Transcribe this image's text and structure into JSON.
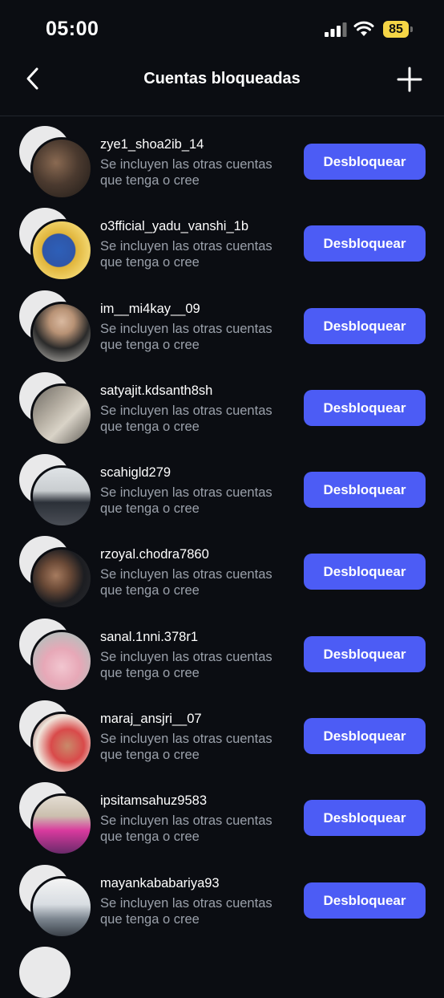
{
  "status_bar": {
    "time": "05:00",
    "battery": "85"
  },
  "header": {
    "title": "Cuentas bloqueadas",
    "back_icon": "chevron-left-icon",
    "add_icon": "plus-icon"
  },
  "accounts": [
    {
      "username": "zye1_shoa2ib_14",
      "subtitle": "Se incluyen las otras cuentas que tenga o cree",
      "button": "Desbloquear"
    },
    {
      "username": "o3fficial_yadu_vanshi_1b",
      "subtitle": "Se incluyen las otras cuentas que tenga o cree",
      "button": "Desbloquear"
    },
    {
      "username": "im__mi4kay__09",
      "subtitle": "Se incluyen las otras cuentas que tenga o cree",
      "button": "Desbloquear"
    },
    {
      "username": "satyajit.kdsanth8sh",
      "subtitle": "Se incluyen las otras cuentas que tenga o cree",
      "button": "Desbloquear"
    },
    {
      "username": "scahigld279",
      "subtitle": "Se incluyen las otras cuentas que tenga o cree",
      "button": "Desbloquear"
    },
    {
      "username": "rzoyal.chodra7860",
      "subtitle": "Se incluyen las otras cuentas que tenga o cree",
      "button": "Desbloquear"
    },
    {
      "username": "sanal.1nni.378r1",
      "subtitle": "Se incluyen las otras cuentas que tenga o cree",
      "button": "Desbloquear"
    },
    {
      "username": "maraj_ansjri__07",
      "subtitle": "Se incluyen las otras cuentas que tenga o cree",
      "button": "Desbloquear"
    },
    {
      "username": "ipsitamsahuz9583",
      "subtitle": "Se incluyen las otras cuentas que tenga o cree",
      "button": "Desbloquear"
    },
    {
      "username": "mayankababariya93",
      "subtitle": "Se incluyen las otras cuentas que tenga o cree",
      "button": "Desbloquear"
    }
  ],
  "colors": {
    "background": "#0b0d12",
    "button": "#4c5cf5",
    "subtitle": "#9aa0aa",
    "battery": "#f5d546"
  }
}
